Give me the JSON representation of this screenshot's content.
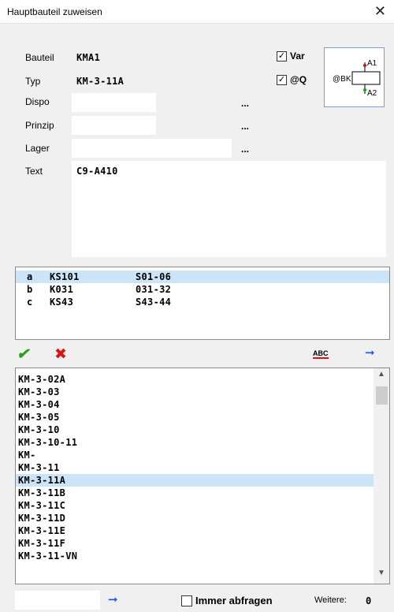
{
  "window": {
    "title": "Hauptbauteil zuweisen",
    "close": "✕"
  },
  "form": {
    "bauteil_label": "Bauteil",
    "bauteil_value": "KMA1",
    "typ_label": "Typ",
    "typ_value": "KM-3-11A",
    "dispo_label": "Dispo",
    "dispo_value": "",
    "prinzip_label": "Prinzip",
    "prinzip_value": "",
    "lager_label": "Lager",
    "lager_value": "",
    "text_label": "Text",
    "text_value": "C9-A410",
    "browse": "...",
    "var_label": "Var",
    "var_checked": true,
    "q_label": "@Q",
    "q_checked": true,
    "check_glyph": "✓"
  },
  "symbol": {
    "bk": "@BK",
    "a1": "A1",
    "a2": "A2"
  },
  "contacts": [
    {
      "letter": "a",
      "code": "KS101",
      "range": "S01-06",
      "selected": true
    },
    {
      "letter": "b",
      "code": "K031",
      "range": "031-32",
      "selected": false
    },
    {
      "letter": "c",
      "code": "KS43",
      "range": "S43-44",
      "selected": false
    }
  ],
  "toolbar": {
    "ok": "✔",
    "cancel": "✖",
    "spell": "ABC",
    "arrow": "➞"
  },
  "types": [
    "KM-3-02A",
    "KM-3-03",
    "KM-3-04",
    "KM-3-05",
    "KM-3-10",
    "KM-3-10-11",
    "KM-",
    "KM-3-11",
    "KM-3-11A",
    "KM-3-11B",
    "KM-3-11C",
    "KM-3-11D",
    "KM-3-11E",
    "KM-3-11F",
    "KM-3-11-VN"
  ],
  "types_selected": "KM-3-11A",
  "bottom": {
    "search_value": "",
    "arrow": "➞",
    "immer_label": "Immer abfragen",
    "immer_checked": false,
    "weitere_label": "Weitere:",
    "weitere_value": "0"
  },
  "colors": {
    "selection": "#cce4f7",
    "ok": "#2e9e1f",
    "cancel": "#e01010",
    "arrow": "#1a56e8",
    "spell_underline": "#e01010"
  }
}
